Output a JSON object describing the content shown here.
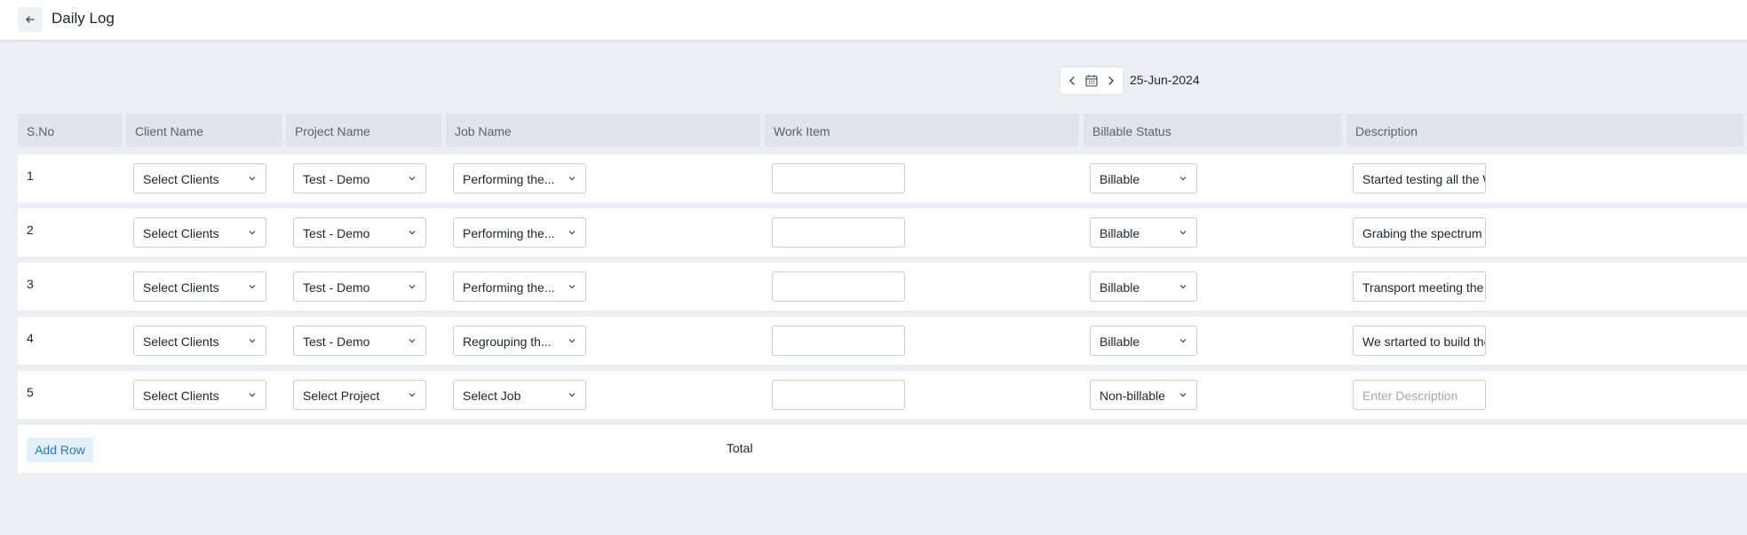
{
  "header": {
    "title": "Daily Log"
  },
  "date_nav": {
    "date": "25-Jun-2024"
  },
  "table": {
    "columns": [
      "S.No",
      "Client Name",
      "Project Name",
      "Job Name",
      "Work Item",
      "Billable Status",
      "Description"
    ],
    "rows": [
      {
        "sno": "1",
        "client": "Select Clients",
        "project": "Test - Demo",
        "job": "Performing the...",
        "work_item": "",
        "billable": "Billable",
        "description": "Started testing all the WiFi s",
        "description_placeholder": ""
      },
      {
        "sno": "2",
        "client": "Select Clients",
        "project": "Test - Demo",
        "job": "Performing the...",
        "work_item": "",
        "billable": "Billable",
        "description": "Grabing the spectrum data",
        "description_placeholder": ""
      },
      {
        "sno": "3",
        "client": "Select Clients",
        "project": "Test - Demo",
        "job": "Performing the...",
        "work_item": "",
        "billable": "Billable",
        "description": "Transport meeting the custo",
        "description_placeholder": ""
      },
      {
        "sno": "4",
        "client": "Select Clients",
        "project": "Test - Demo",
        "job": "Regrouping th...",
        "work_item": "",
        "billable": "Billable",
        "description": "We srtarted to build the con",
        "description_placeholder": ""
      },
      {
        "sno": "5",
        "client": "Select Clients",
        "project": "Select Project",
        "job": "Select Job",
        "work_item": "",
        "billable": "Non-billable",
        "description": "",
        "description_placeholder": "Enter Description"
      }
    ]
  },
  "footer": {
    "add_row_label": "Add Row",
    "total_label": "Total"
  },
  "colors": {
    "accent": "#1a7ad4",
    "background": "#eceef3",
    "header_cell": "#e2e4ec"
  },
  "icons": {
    "back": "arrow-left-icon",
    "prev": "chevron-left-icon",
    "next": "chevron-right-icon",
    "calendar": "calendar-icon",
    "dropdown": "chevron-down-icon"
  }
}
